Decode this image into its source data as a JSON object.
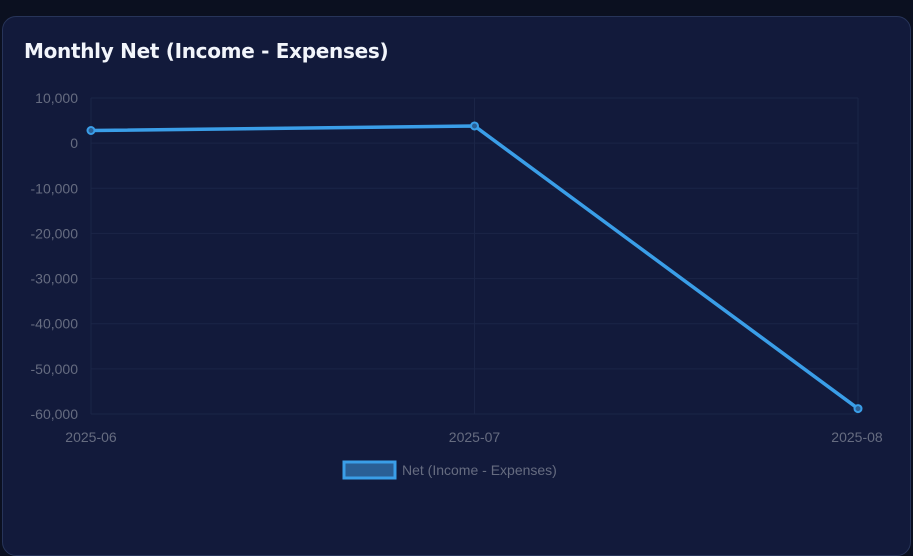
{
  "title": "Monthly Net (Income - Expenses)",
  "colors": {
    "line": "#3a9ee8",
    "legend_fill": "#2a5f96",
    "grid": "#1b2547",
    "tick_text": "#666c80",
    "card_bg": "#121a3b"
  },
  "chart_data": {
    "type": "line",
    "categories": [
      "2025-06",
      "2025-07",
      "2025-08"
    ],
    "series": [
      {
        "name": "Net (Income - Expenses)",
        "values": [
          2800,
          3800,
          -58800
        ]
      }
    ],
    "ylim": [
      -60000,
      10000
    ],
    "yticks": [
      10000,
      0,
      -10000,
      -20000,
      -30000,
      -40000,
      -50000,
      -60000
    ],
    "ytick_labels": [
      "10,000",
      "0",
      "-10,000",
      "-20,000",
      "-30,000",
      "-40,000",
      "-50,000",
      "-60,000"
    ],
    "grid": true,
    "legend_position": "bottom"
  }
}
